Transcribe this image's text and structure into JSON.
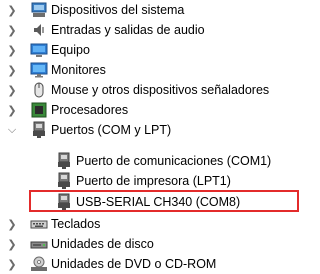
{
  "tree": {
    "items": [
      {
        "label": "Dispositivos del sistema",
        "icon": "system-devices-icon",
        "state": "collapsed"
      },
      {
        "label": "Entradas y salidas de audio",
        "icon": "speaker-icon",
        "state": "collapsed"
      },
      {
        "label": "Equipo",
        "icon": "computer-icon",
        "state": "collapsed"
      },
      {
        "label": "Monitores",
        "icon": "monitor-icon",
        "state": "collapsed"
      },
      {
        "label": "Mouse y otros dispositivos señaladores",
        "icon": "mouse-icon",
        "state": "collapsed"
      },
      {
        "label": "Procesadores",
        "icon": "processor-icon",
        "state": "collapsed"
      },
      {
        "label": "Puertos (COM y LPT)",
        "icon": "port-icon",
        "state": "expanded"
      },
      {
        "label": "Puerto de comunicaciones (COM1)",
        "icon": "port-icon",
        "state": "child"
      },
      {
        "label": "Puerto de impresora (LPT1)",
        "icon": "port-icon",
        "state": "child"
      },
      {
        "label": "USB-SERIAL CH340 (COM8)",
        "icon": "port-icon",
        "state": "child",
        "highlighted": true
      },
      {
        "label": "Teclados",
        "icon": "keyboard-icon",
        "state": "collapsed"
      },
      {
        "label": "Unidades de disco",
        "icon": "disk-drive-icon",
        "state": "collapsed"
      },
      {
        "label": "Unidades de DVD o CD-ROM",
        "icon": "dvd-drive-icon",
        "state": "collapsed"
      }
    ]
  },
  "colors": {
    "highlight_border": "#e32b2b",
    "chevron": "#6b6b6b"
  }
}
